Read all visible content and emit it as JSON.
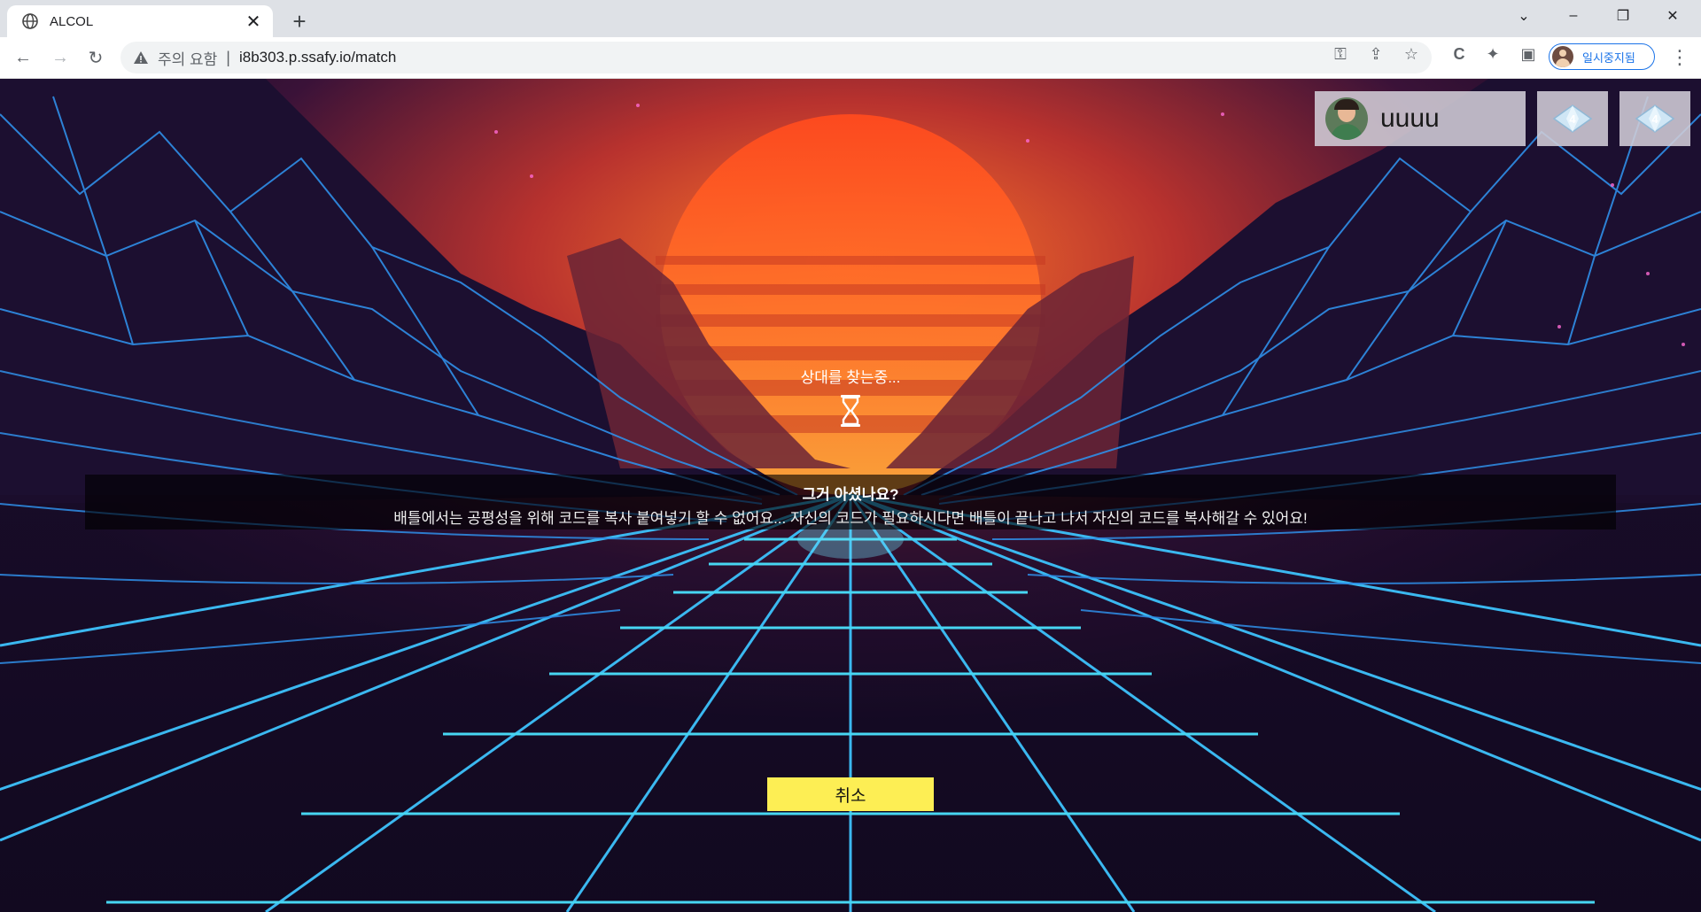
{
  "browser": {
    "tab_title": "ALCOL",
    "address_warning": "주의 요함",
    "address_separator": "|",
    "url": "i8b303.p.ssafy.io/match",
    "profile_label": "일시중지됨"
  },
  "header": {
    "username": "uuuu",
    "tier_badges": [
      "4",
      "4"
    ]
  },
  "matching": {
    "status": "상대를 찾는중...",
    "tip_title": "그거 아셨나요?",
    "tip_body": "배틀에서는 공평성을 위해 코드를 복사 붙여넣기 할 수 없어요... 자신의 코드가 필요하시다면 배틀이 끝나고 나서 자신의 코드를 복사해갈 수 있어요!",
    "cancel_label": "취소"
  },
  "colors": {
    "cancel_button": "#fdee54",
    "grid_cyan": "#3fd8f0",
    "sun_orange": "#f26a2b",
    "night": "#140b23"
  }
}
